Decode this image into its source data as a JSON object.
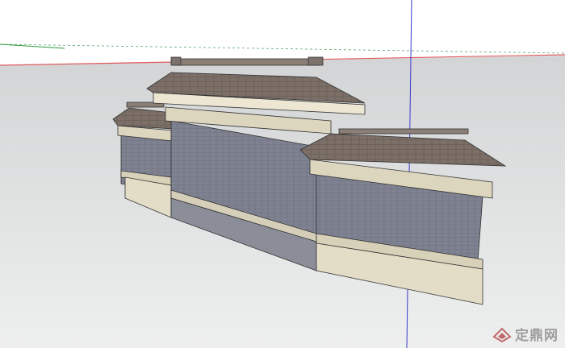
{
  "watermark": {
    "text": "定鼎网",
    "logo_icon": "dingding-logo-icon"
  },
  "colors": {
    "sky": "#ffffff",
    "ground_top": "#d3d5d6",
    "ground_bottom": "#eceded",
    "horizon_red": "#e05a5a",
    "horizon_green": "#57a36a",
    "axis_blue": "#3a3acc",
    "axis_green": "#2f9a3a",
    "wall_gray": "#7f8290",
    "roof": "#786c66",
    "trim": "#ddd6bf",
    "trim_light": "#ece6d2"
  }
}
